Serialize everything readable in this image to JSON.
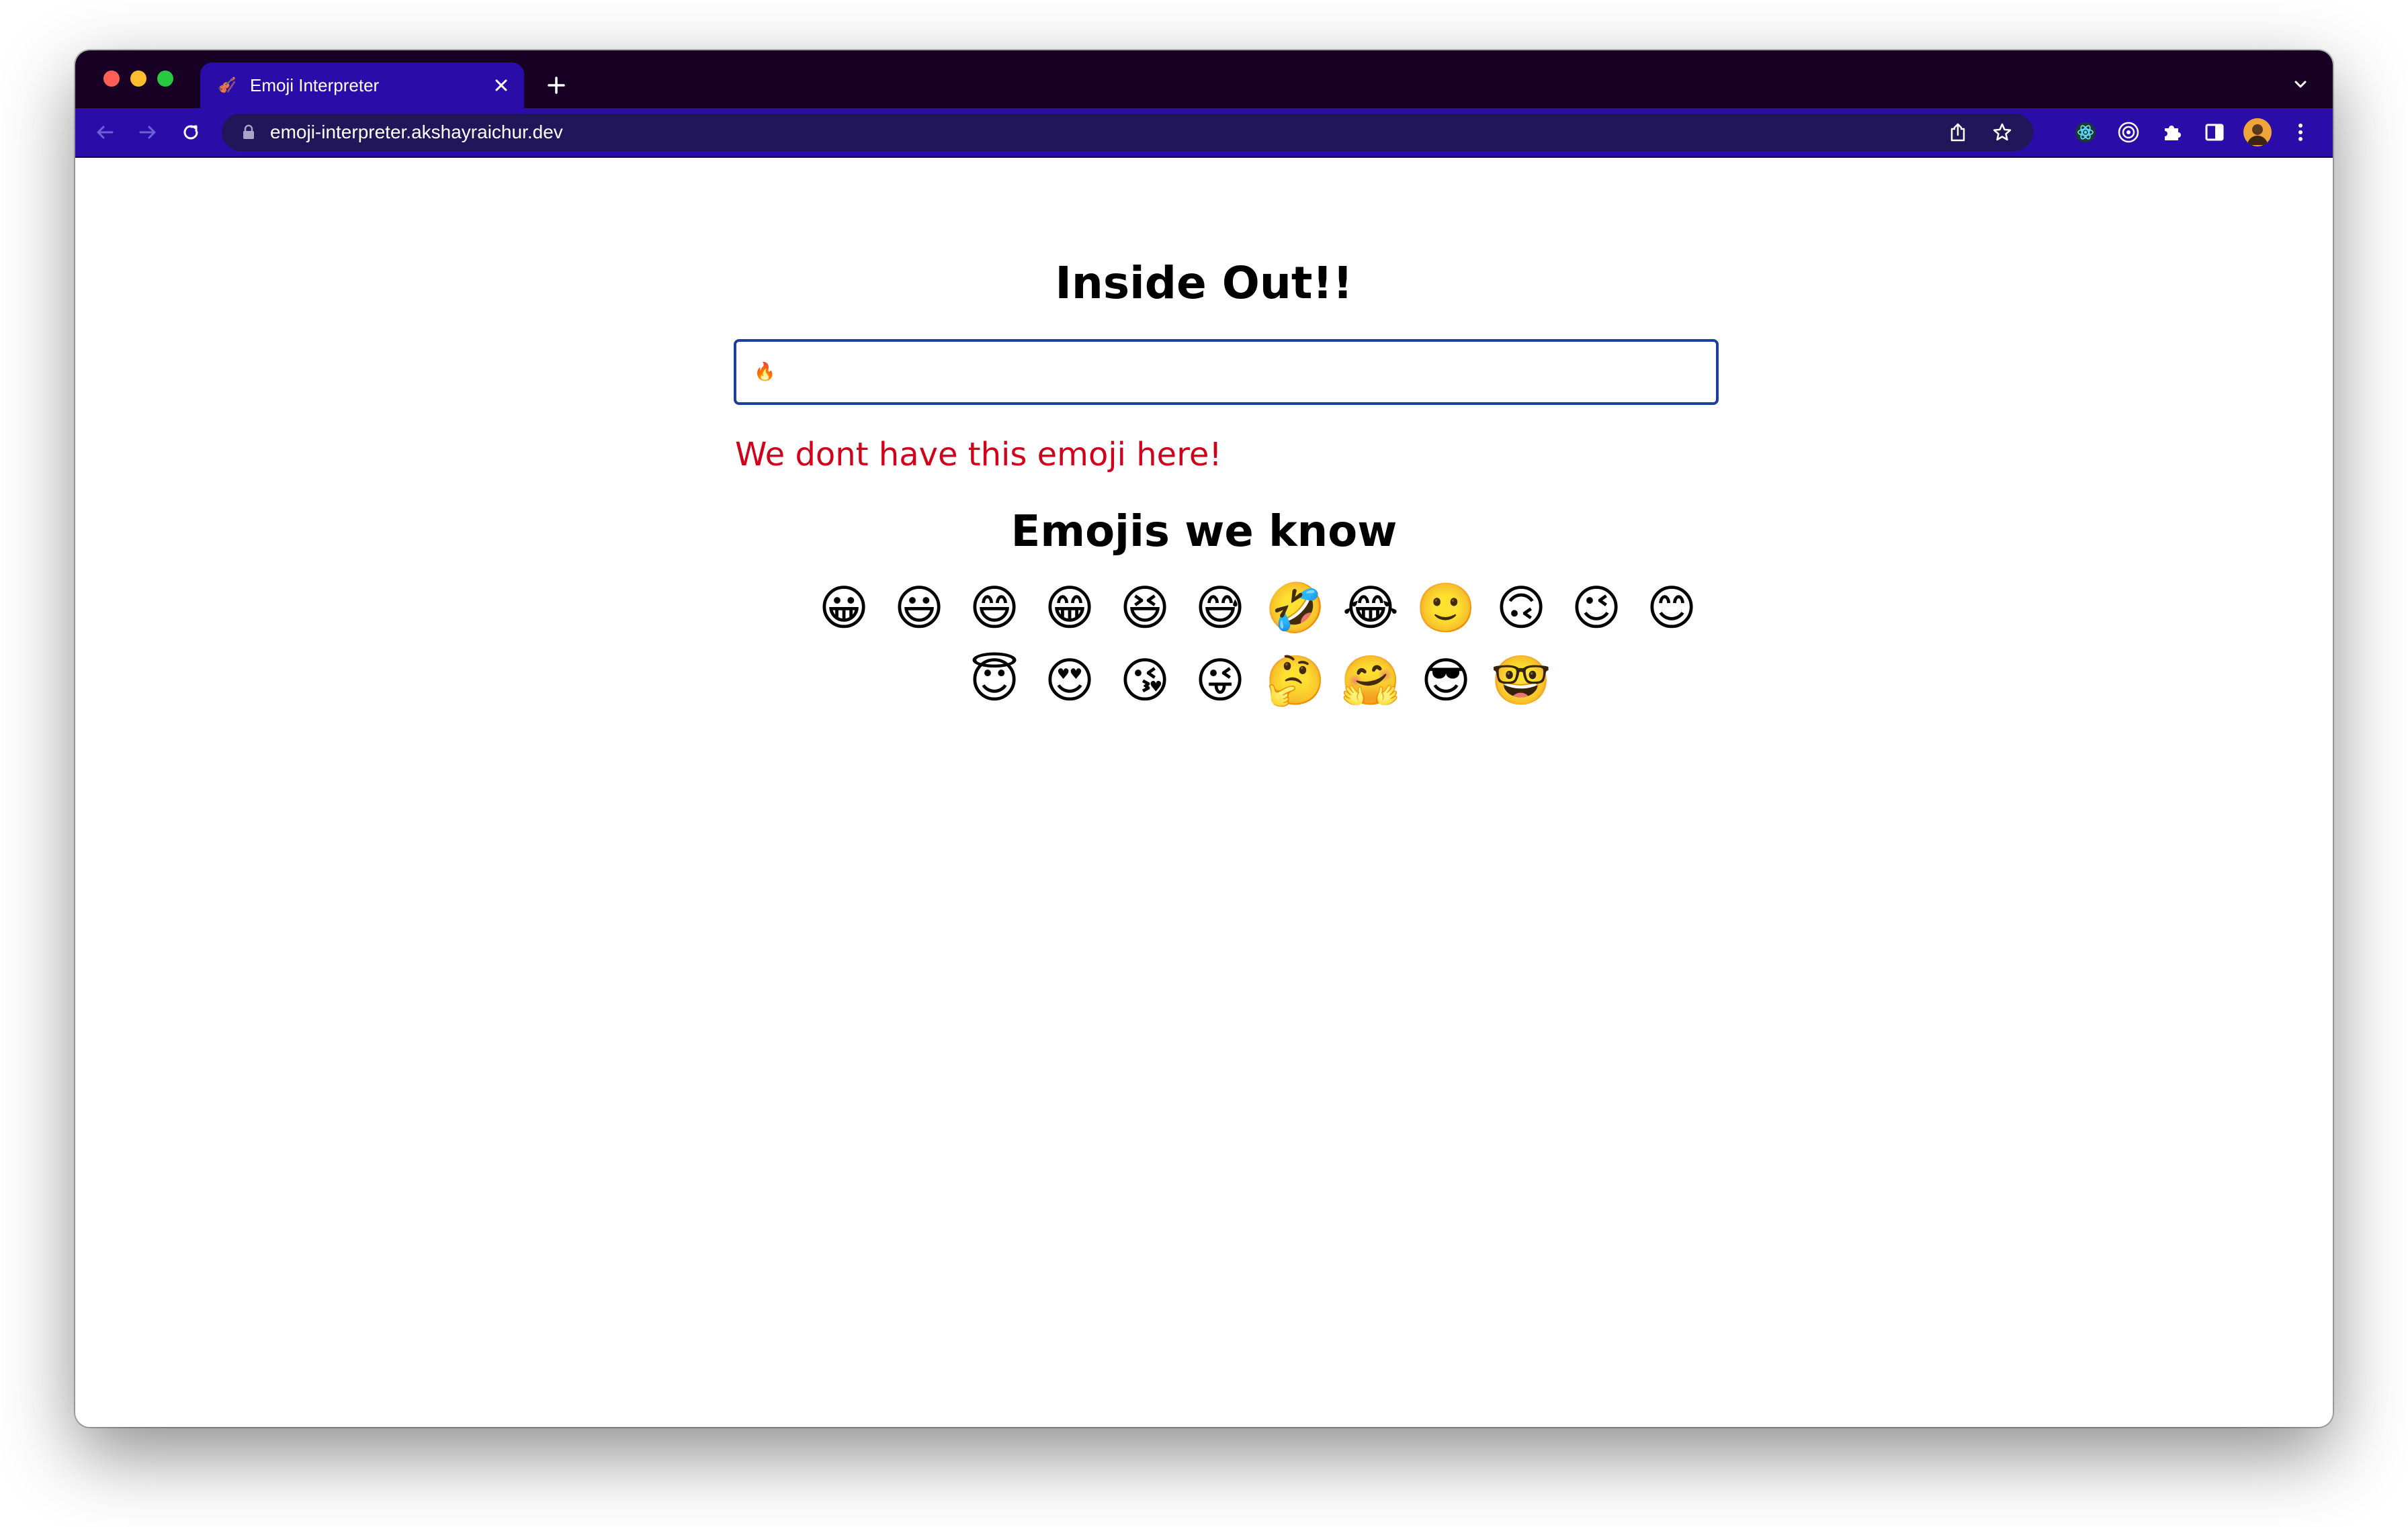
{
  "browser": {
    "tab": {
      "favicon": "🎻",
      "title": "Emoji Interpreter"
    },
    "address_bar": {
      "url": "emoji-interpreter.akshayraichur.dev"
    },
    "colors": {
      "tabstrip": "#170024",
      "toolbar": "#2a0ca8",
      "omnibox": "#21165a"
    }
  },
  "page": {
    "title": "Inside Out!!",
    "input": {
      "value": "🔥"
    },
    "message": "We dont have this emoji here!",
    "known_heading": "Emojis we know",
    "emojis": [
      "😀",
      "😃",
      "😄",
      "😁",
      "😆",
      "😅",
      "🤣",
      "😂",
      "🙂",
      "🙃",
      "😉",
      "😊",
      "😇",
      "😍",
      "😘",
      "😜",
      "🤔",
      "🤗",
      "😎",
      "🤓"
    ],
    "colors": {
      "message": "#d0011b",
      "input_border": "#1b3f9e"
    }
  }
}
